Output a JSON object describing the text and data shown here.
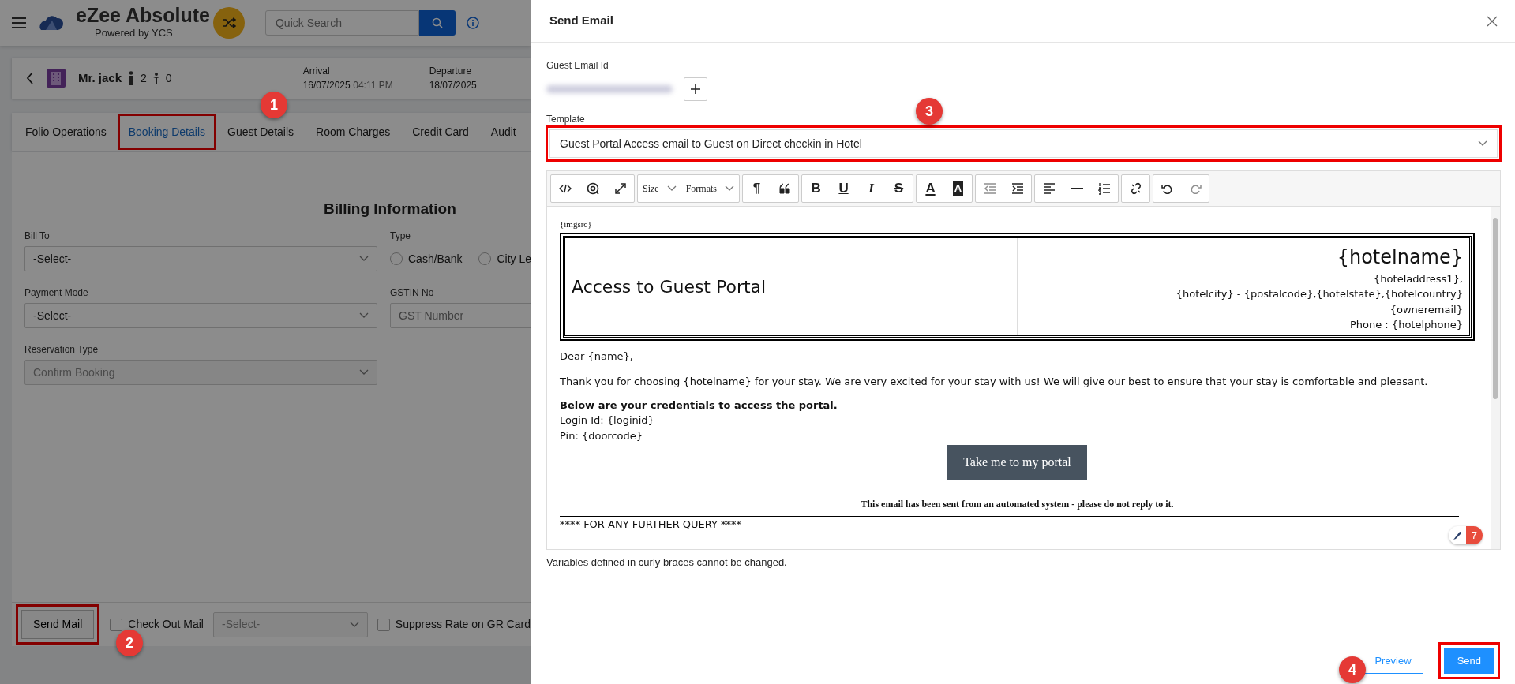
{
  "app": {
    "logo_title": "eZee Absolute",
    "logo_subtitle": "Powered by YCS",
    "search": {
      "placeholder": "Quick Search"
    }
  },
  "booking": {
    "guest": "Mr. jack",
    "adults": "2",
    "children": "0",
    "arrival": {
      "label": "Arrival",
      "date": "16/07/2025",
      "time": "04:11 PM"
    },
    "departure": {
      "label": "Departure",
      "date": "18/07/2025"
    }
  },
  "tabs": [
    {
      "label": "Folio Operations",
      "selected": false
    },
    {
      "label": "Booking Details",
      "selected": true
    },
    {
      "label": "Guest Details",
      "selected": false
    },
    {
      "label": "Room Charges",
      "selected": false
    },
    {
      "label": "Credit Card",
      "selected": false
    },
    {
      "label": "Audit",
      "selected": false
    }
  ],
  "billing": {
    "title": "Billing Information",
    "left_fields": [
      {
        "label": "Bill To",
        "value": "-Select-",
        "disabled": false
      },
      {
        "label": "Payment Mode",
        "value": "-Select-",
        "disabled": false
      },
      {
        "label": "Reservation Type",
        "value": "Confirm Booking",
        "disabled": true
      }
    ],
    "type": {
      "label": "Type",
      "options": [
        {
          "label": "Cash/Bank",
          "selected": false
        },
        {
          "label": "City Le",
          "selected": false
        }
      ]
    },
    "gstin": {
      "label": "GSTIN No",
      "placeholder": "GST Number"
    }
  },
  "footer": {
    "send_mail": "Send Mail",
    "checkout_mail": {
      "label": "Check Out Mail",
      "checked": false
    },
    "checkout_select": "-Select-",
    "suppress_rate": {
      "label": "Suppress Rate on GR Card",
      "checked": false
    }
  },
  "modal": {
    "title": "Send Email",
    "email_label": "Guest Email Id",
    "template_label": "Template",
    "template_value": "Guest Portal Access email to Guest on Direct checkin in Hotel",
    "toolbar": [
      [
        {
          "kind": "code",
          "disabled": false
        },
        {
          "kind": "mention",
          "disabled": false
        },
        {
          "kind": "fullscreen",
          "disabled": false
        }
      ],
      [
        {
          "kind": "dropdown",
          "text": "Size",
          "disabled": false
        },
        {
          "kind": "dropdown",
          "text": "Formats",
          "disabled": false
        }
      ],
      [
        {
          "kind": "glyph",
          "text": "¶",
          "disabled": false
        },
        {
          "kind": "quote",
          "disabled": false
        }
      ],
      [
        {
          "kind": "glyph",
          "text": "B",
          "disabled": false
        },
        {
          "kind": "underline",
          "text": "U",
          "disabled": false
        },
        {
          "kind": "italic",
          "text": "I",
          "disabled": false
        },
        {
          "kind": "strike",
          "text": "S",
          "disabled": false
        }
      ],
      [
        {
          "kind": "fontcolor",
          "text": "A",
          "disabled": false
        },
        {
          "kind": "bgcolor",
          "text": "A",
          "disabled": false
        }
      ],
      [
        {
          "kind": "outdent",
          "disabled": true
        },
        {
          "kind": "indent",
          "disabled": false
        }
      ],
      [
        {
          "kind": "align",
          "disabled": false
        },
        {
          "kind": "rule",
          "disabled": false
        },
        {
          "kind": "list",
          "disabled": false
        }
      ],
      [
        {
          "kind": "unlink",
          "disabled": false
        }
      ],
      [
        {
          "kind": "undo",
          "disabled": false
        },
        {
          "kind": "redo",
          "disabled": true
        }
      ]
    ],
    "body": {
      "imgsrc": "{imgsrc}",
      "header_title": "Access to Guest Portal",
      "hotel_lines": [
        "{hotelname}",
        "{hoteladdress1},",
        "{hotelcity} - {postalcode},{hotelstate},{hotelcountry}",
        "{owneremail}",
        "Phone : {hotelphone}"
      ],
      "greeting": "Dear {name},",
      "intro": "Thank you for choosing {hotelname} for your stay. We are very excited for your stay with us! We will give our best to ensure that your stay is comfortable and pleasant.",
      "credentials_heading": "Below are your credentials to access the portal.",
      "credentials": [
        "Login Id: {loginid}",
        "Pin: {doorcode}"
      ],
      "cta": "Take me to my portal",
      "disclaimer": "This email has been sent from an automated system - please do not reply to it.",
      "query": "**** FOR ANY FURTHER QUERY ****"
    },
    "counter": "7",
    "note": "Variables defined in curly braces cannot be changed.",
    "buttons": [
      {
        "label": "Preview",
        "kind": "outline"
      },
      {
        "label": "Send",
        "kind": "primary"
      }
    ]
  },
  "callouts": [
    "1",
    "2",
    "3",
    "4"
  ]
}
